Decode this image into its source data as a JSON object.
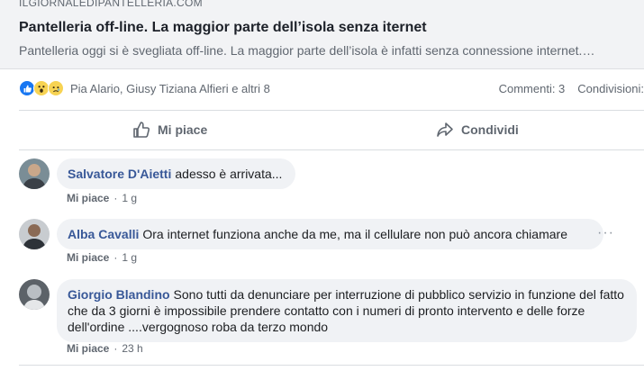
{
  "link_preview": {
    "domain": "ILGIORNALEDIPANTELLERIA.COM",
    "title": "Pantelleria off-line. La maggior parte dell’isola senza iternet",
    "description": "Pantelleria oggi si è svegliata off-line. La maggior parte dell’isola è infatti senza connessione internet.…"
  },
  "reactions": {
    "icons": [
      "like-icon",
      "wow-icon",
      "sad-icon"
    ],
    "names": "Pia Alario, Giusy Tiziana Alfieri e altri 8",
    "comments": "Commenti: 3",
    "shares": "Condivisioni:"
  },
  "actions": {
    "like": "Mi piace",
    "share": "Condividi"
  },
  "comments": [
    {
      "author": "Salvatore D'Aietti",
      "text": "adesso è arrivata...",
      "like_label": "Mi piace",
      "time": "1 g"
    },
    {
      "author": "Alba Cavalli",
      "text": "Ora internet funziona anche da me, ma il cellulare non può ancora chiamare",
      "like_label": "Mi piace",
      "time": "1 g"
    },
    {
      "author": "Giorgio Blandino",
      "text": "Sono tutti da denunciare per interruzione di pubblico servizio in funzione del fatto che da 3 giorni è impossibile prendere contatto con i numeri di pronto intervento e delle forze dell'ordine ....vergognoso roba da terzo mondo",
      "like_label": "Mi piace",
      "time": "23 h"
    }
  ],
  "more_options": "···"
}
